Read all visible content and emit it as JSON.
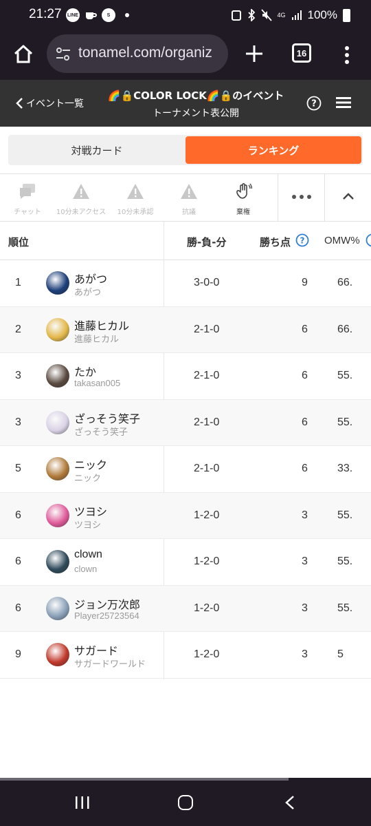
{
  "status": {
    "time": "21:27",
    "battery": "100%",
    "network": "4G"
  },
  "browser": {
    "url": "tonamel.com/organiz",
    "tab_count": "16"
  },
  "header": {
    "back_label": "イベント一覧",
    "title": "🌈🔒COLOR LOCK🌈🔒のイベント",
    "subtitle": "トーナメント表公開"
  },
  "tabs": {
    "matches": "対戦カード",
    "ranking": "ランキング"
  },
  "toolbar": {
    "chat": "チャット",
    "access": "10分未アクセス",
    "unapproved": "10分未承認",
    "protest": "抗議",
    "forfeit": "棄権"
  },
  "table": {
    "col_rank": "順位",
    "col_record": "勝-負-分",
    "col_points": "勝ち点",
    "col_omw": "OMW%",
    "rows": [
      {
        "rank": "1",
        "name": "あがつ",
        "id": "あがつ",
        "record": "3-0-0",
        "points": "9",
        "omw": "66.",
        "avatar_color": "#1d3f7a"
      },
      {
        "rank": "2",
        "name": "進藤ヒカル",
        "id": "進藤ヒカル",
        "record": "2-1-0",
        "points": "6",
        "omw": "66.",
        "avatar_color": "#e3b84a"
      },
      {
        "rank": "3",
        "name": "たか",
        "id": "takasan005",
        "record": "2-1-0",
        "points": "6",
        "omw": "55.",
        "avatar_color": "#5a4a40"
      },
      {
        "rank": "3",
        "name": "ざっそう笑子",
        "id": "ざっそう笑子",
        "record": "2-1-0",
        "points": "6",
        "omw": "55.",
        "avatar_color": "#d9d2e6"
      },
      {
        "rank": "5",
        "name": "ニック",
        "id": "ニック",
        "record": "2-1-0",
        "points": "6",
        "omw": "33.",
        "avatar_color": "#b07a3a"
      },
      {
        "rank": "6",
        "name": "ツヨシ",
        "id": "ツヨシ",
        "record": "1-2-0",
        "points": "3",
        "omw": "55.",
        "avatar_color": "#e05a9a"
      },
      {
        "rank": "6",
        "name": "clown",
        "id": "clown",
        "record": "1-2-0",
        "points": "3",
        "omw": "55.",
        "avatar_color": "#2f4a5a"
      },
      {
        "rank": "6",
        "name": "ジョン万次郎",
        "id": "Player25723564",
        "record": "1-2-0",
        "points": "3",
        "omw": "55.",
        "avatar_color": "#8aa0b8"
      },
      {
        "rank": "9",
        "name": "サガード",
        "id": "サガードワールド",
        "record": "1-2-0",
        "points": "3",
        "omw": "5",
        "avatar_color": "#c0392b"
      }
    ]
  },
  "colors": {
    "accent": "#ff6a2a",
    "header_bg": "#333333",
    "system_bg": "#1f1a24",
    "help_blue": "#2f7fd6"
  }
}
